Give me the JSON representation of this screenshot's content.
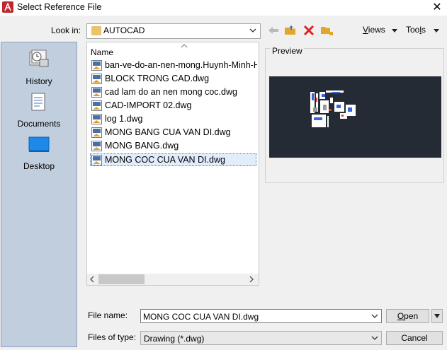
{
  "window": {
    "title": "Select Reference File",
    "close_symbol": "✕"
  },
  "lookin": {
    "label": "Look in:",
    "value": "AUTOCAD"
  },
  "toolbar": {
    "views_label": "Views",
    "views_accel": "V",
    "views_rest": "iews",
    "tools_label": "Tools",
    "tools_pre": "Too",
    "tools_accel": "l",
    "tools_post": "s",
    "icons": [
      "back-arrow-icon",
      "folder-up-icon",
      "delete-icon",
      "new-folder-icon"
    ]
  },
  "places": [
    {
      "label": "History",
      "icon": "history-icon"
    },
    {
      "label": "Documents",
      "icon": "documents-icon"
    },
    {
      "label": "Desktop",
      "icon": "desktop-icon"
    }
  ],
  "filelist": {
    "column_name": "Name",
    "files": [
      {
        "name": "ban-ve-do-an-nen-mong.Huynh-Minh-Hieu.dwg"
      },
      {
        "name": "BLOCK TRONG CAD.dwg"
      },
      {
        "name": "cad lam do an nen mong coc.dwg"
      },
      {
        "name": "CAD-IMPORT 02.dwg"
      },
      {
        "name": "log 1.dwg"
      },
      {
        "name": "MONG BANG CUA VAN DI.dwg"
      },
      {
        "name": "MONG BANG.dwg"
      },
      {
        "name": "MONG COC CUA VAN DI.dwg",
        "selected": true
      }
    ]
  },
  "preview": {
    "label": "Preview"
  },
  "footer": {
    "filename_label": "File name:",
    "filename_value": "MONG COC CUA VAN DI.dwg",
    "filetype_label": "Files of type:",
    "filetype_value": "Drawing (*.dwg)",
    "open_accel": "O",
    "open_rest": "pen",
    "cancel_label": "Cancel"
  },
  "colors": {
    "places_bg": "#c0cede",
    "selection": "#e1edfa",
    "preview_bg": "#252b35",
    "accent_red": "#c0262d"
  }
}
